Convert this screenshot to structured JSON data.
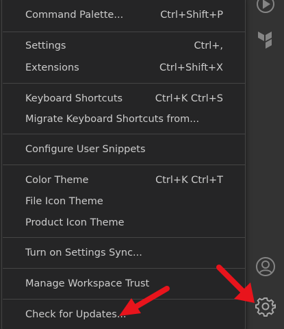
{
  "menu": {
    "items": [
      {
        "label": "Command Palette...",
        "keybinding": "Ctrl+Shift+P"
      },
      {
        "label": "Settings",
        "keybinding": "Ctrl+,"
      },
      {
        "label": "Extensions",
        "keybinding": "Ctrl+Shift+X"
      },
      {
        "label": "Keyboard Shortcuts",
        "keybinding": "Ctrl+K Ctrl+S"
      },
      {
        "label": "Migrate Keyboard Shortcuts from...",
        "keybinding": ""
      },
      {
        "label": "Configure User Snippets",
        "keybinding": ""
      },
      {
        "label": "Color Theme",
        "keybinding": "Ctrl+K Ctrl+T"
      },
      {
        "label": "File Icon Theme",
        "keybinding": ""
      },
      {
        "label": "Product Icon Theme",
        "keybinding": ""
      },
      {
        "label": "Turn on Settings Sync...",
        "keybinding": ""
      },
      {
        "label": "Manage Workspace Trust",
        "keybinding": ""
      },
      {
        "label": "Check for Updates...",
        "keybinding": ""
      }
    ]
  },
  "activity_bar": {
    "icons": [
      "run-debug-icon",
      "terraform-icon",
      "accounts-icon",
      "manage-gear-icon"
    ]
  },
  "annotations": {
    "arrow_color": "#e8141c"
  },
  "colors": {
    "menu_background": "#252526",
    "menu_text": "#cccccc",
    "separator": "#454545",
    "activity_bar": "#333333"
  }
}
